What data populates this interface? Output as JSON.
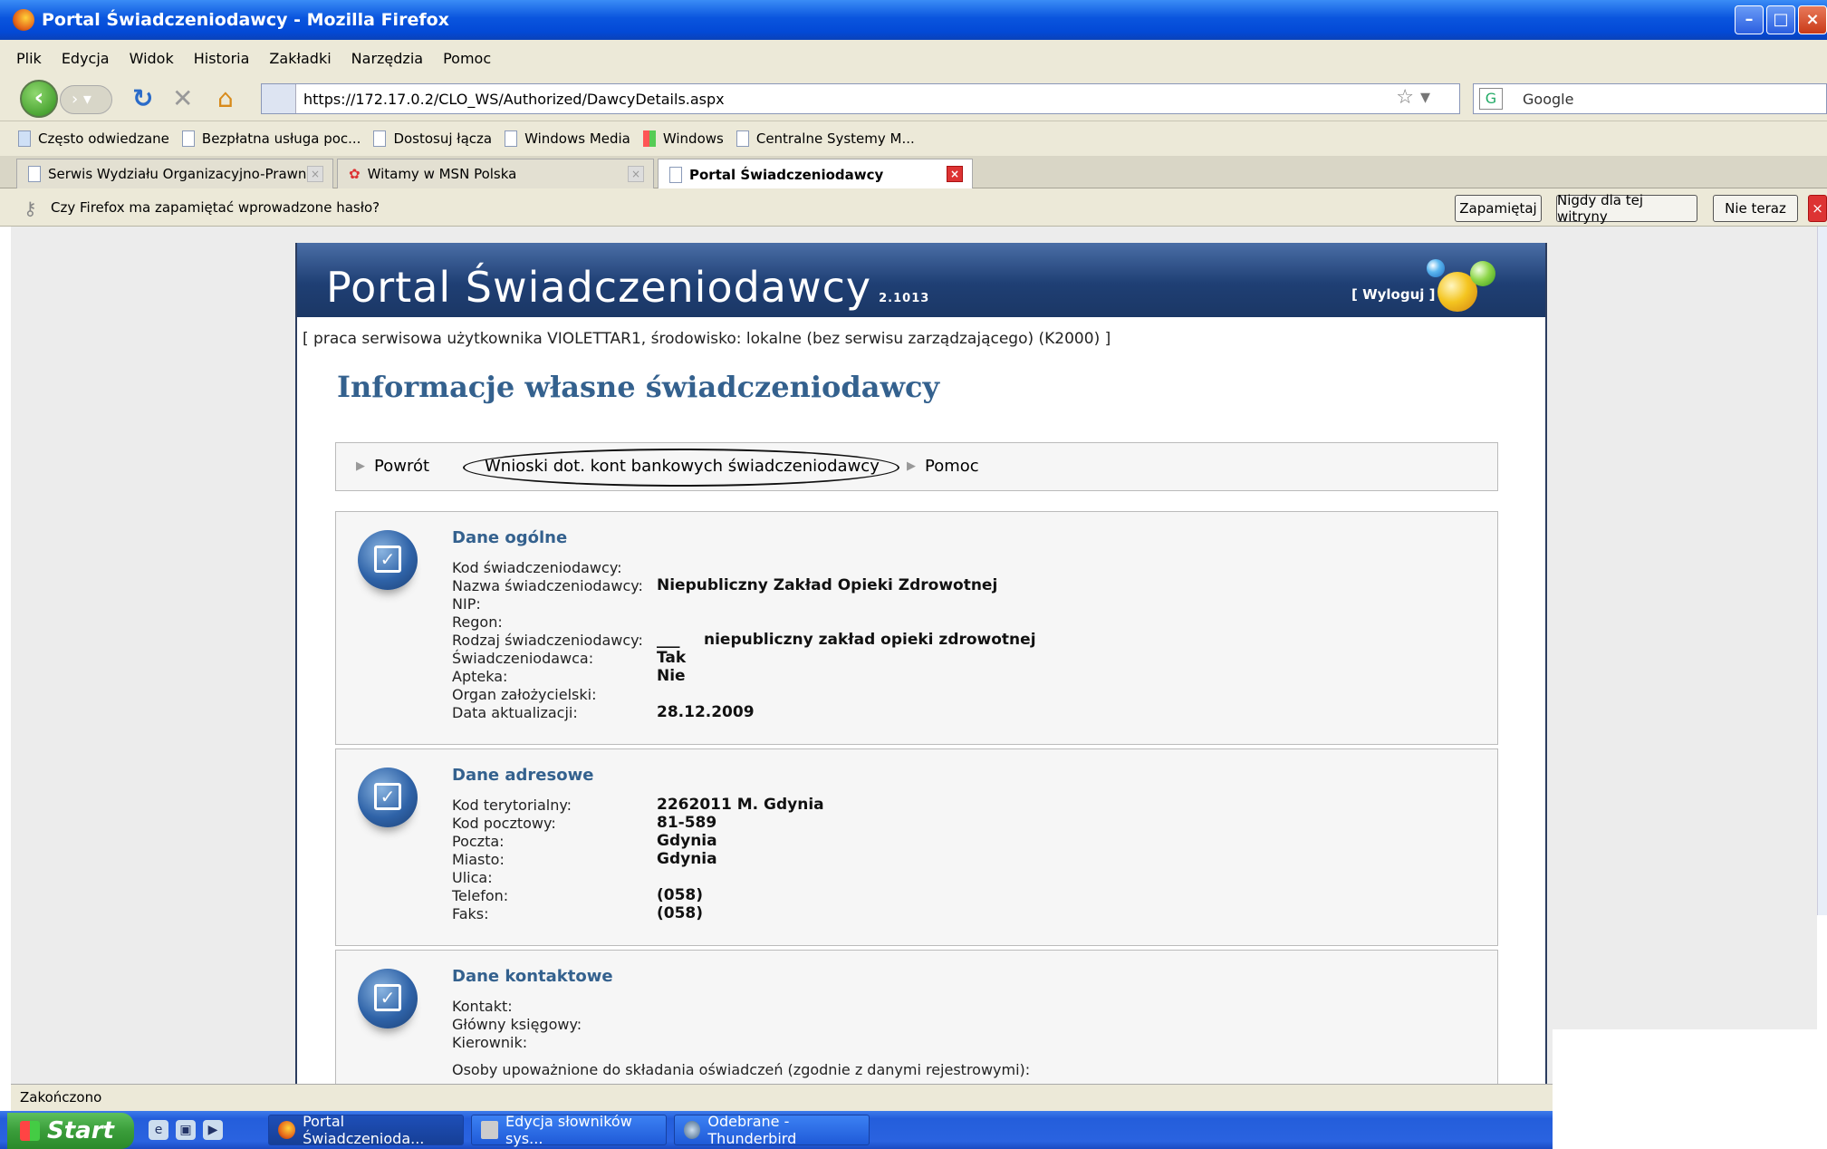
{
  "window": {
    "title": "Portal Świadczeniodawcy - Mozilla Firefox"
  },
  "menu": [
    "Plik",
    "Edycja",
    "Widok",
    "Historia",
    "Zakładki",
    "Narzędzia",
    "Pomoc"
  ],
  "nav": {
    "url": "https://172.17.0.2/CLO_WS/Authorized/DawcyDetails.aspx",
    "search_placeholder": "Google"
  },
  "bookmarks": [
    "Często odwiedzane",
    "Bezpłatna usługa poc...",
    "Dostosuj łącza",
    "Windows Media",
    "Windows",
    "Centralne Systemy M..."
  ],
  "tabs": [
    "Serwis Wydziału Organizacyjno-Prawn...",
    "Witamy w MSN Polska",
    "Portal Świadczeniodawcy"
  ],
  "notification": {
    "text": "Czy Firefox ma zapamiętać wprowadzone hasło?",
    "remember": "Zapamiętaj",
    "never": "Nigdy dla tej witryny",
    "not_now": "Nie teraz"
  },
  "portal": {
    "title": "Portal Świadczeniodawcy",
    "version": "2.1013",
    "logout": "[ Wyloguj ]",
    "service_line": "[ praca serwisowa użytkownika VIOLETTAR1, środowisko: lokalne (bez serwisu zarządzającego) (K2000) ]",
    "heading": "Informacje własne świadczeniodawcy",
    "menu": {
      "back": "Powrót",
      "requests": "Wnioski dot. kont bankowych świadczeniodawcy",
      "help": "Pomoc"
    }
  },
  "general": {
    "title": "Dane ogólne",
    "labels": [
      "Kod świadczeniodawcy:",
      "Nazwa świadczeniodawcy:",
      "NIP:",
      "Regon:",
      "Rodzaj świadczeniodawcy:",
      "Świadczeniodawca:",
      "Apteka:",
      "Organ założycielski:",
      "Data aktualizacji:"
    ],
    "name": "Niepubliczny Zakład Opieki Zdrowotnej",
    "type_code": "___",
    "type": "niepubliczny zakład opieki zdrowotnej",
    "provider": "Tak",
    "pharmacy": "Nie",
    "updated": "28.12.2009"
  },
  "address": {
    "title": "Dane adresowe",
    "labels": [
      "Kod terytorialny:",
      "Kod pocztowy:",
      "Poczta:",
      "Miasto:",
      "Ulica:",
      "Telefon:",
      "Faks:"
    ],
    "territorial": "2262011  M. Gdynia",
    "postal": "81-589",
    "post": "Gdynia",
    "city": "Gdynia",
    "phone": "(058)",
    "fax": "(058)"
  },
  "contact": {
    "title": "Dane kontaktowe",
    "labels": [
      "Kontakt:",
      "Główny księgowy:",
      "Kierownik:"
    ],
    "authorized": "Osoby upoważnione do składania oświadczeń (zgodnie z danymi rejestrowymi):"
  },
  "status": "Zakończono",
  "taskbar": {
    "start": "Start",
    "tasks": [
      "Portal Świadczenioda...",
      "Edycja słowników sys...",
      "Odebrane - Thunderbird"
    ]
  }
}
